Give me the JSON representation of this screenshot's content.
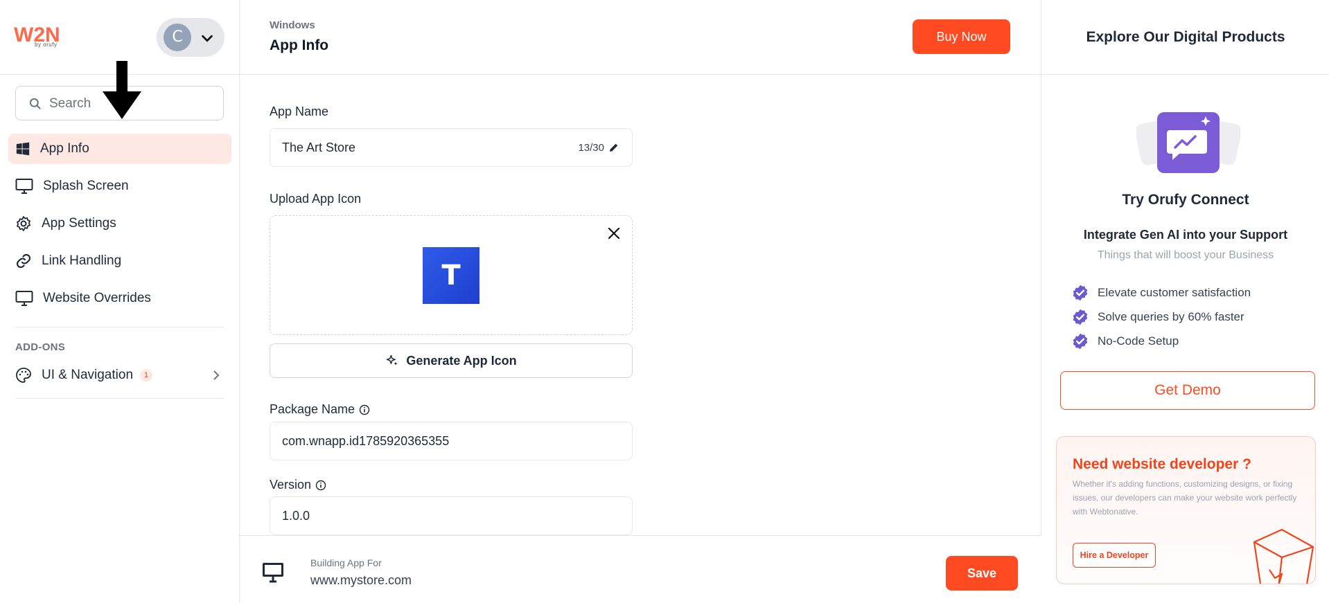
{
  "brand": {
    "logo_text": "W2N",
    "logo_sub": "by orufy"
  },
  "profile": {
    "initial": "C"
  },
  "search": {
    "placeholder": "Search"
  },
  "nav": {
    "items": [
      {
        "label": "App Info",
        "icon": "windows-icon"
      },
      {
        "label": "Splash Screen",
        "icon": "monitor-icon"
      },
      {
        "label": "App Settings",
        "icon": "gear-icon"
      },
      {
        "label": "Link Handling",
        "icon": "link-icon"
      },
      {
        "label": "Website Overrides",
        "icon": "monitor-icon"
      }
    ],
    "addons_label": "ADD-ONS",
    "addon": {
      "label": "UI & Navigation",
      "badge": "1",
      "icon": "palette-icon"
    }
  },
  "header": {
    "breadcrumb": "Windows",
    "title": "App Info",
    "buy_label": "Buy Now"
  },
  "form": {
    "app_name_label": "App Name",
    "app_name_value": "The Art Store",
    "app_name_count": "13/30",
    "upload_label": "Upload App Icon",
    "app_icon_letter": "T",
    "generate_label": "Generate App Icon",
    "package_label": "Package Name",
    "package_value": "com.wnapp.id1785920365355",
    "version_label": "Version",
    "version_value": "1.0.0"
  },
  "footer": {
    "building_label": "Building App For",
    "url": "www.mystore.com",
    "save_label": "Save"
  },
  "right": {
    "title": "Explore Our Digital Products",
    "promo_title": "Try Orufy Connect",
    "promo_subtitle": "Integrate Gen AI into your Support",
    "promo_tagline": "Things that will boost your Business",
    "features": [
      "Elevate customer satisfaction",
      "Solve queries by 60% faster",
      "No-Code Setup"
    ],
    "demo_label": "Get Demo",
    "dev_title": "Need website developer ?",
    "dev_text": "Whether it's adding functions, customizing designs, or fixing issues, our developers can make your website work perfectly with Webtonative.",
    "hire_label": "Hire a Developer"
  },
  "colors": {
    "accent": "#ff4a22",
    "active_bg": "#fde8e4",
    "promo_purple": "#7c5cd6"
  }
}
